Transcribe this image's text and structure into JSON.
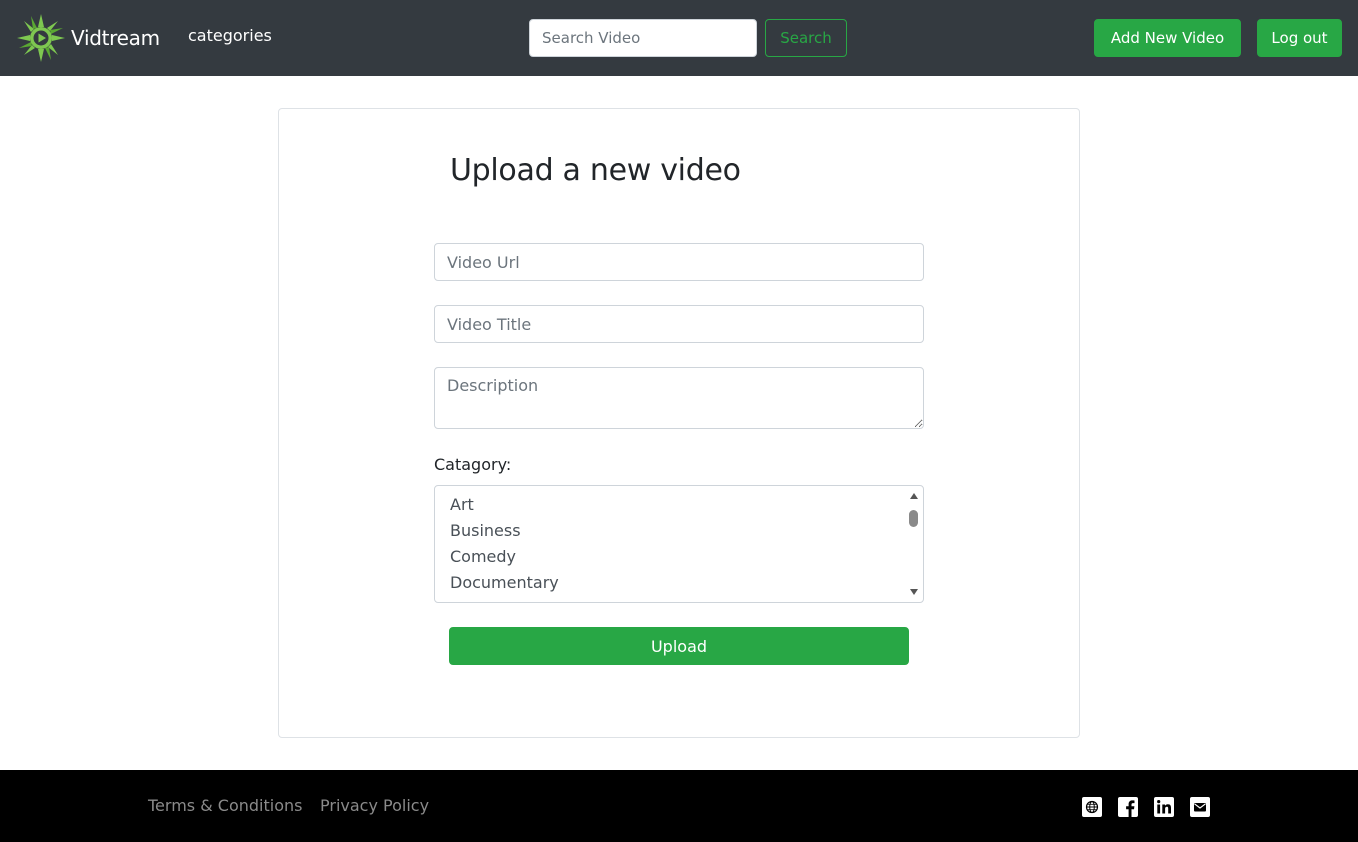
{
  "header": {
    "brand": "Vidtream",
    "nav_categories": "categories",
    "search_placeholder": "Search Video",
    "search_button": "Search",
    "add_button": "Add New Video",
    "logout_button": "Log out"
  },
  "form": {
    "title": "Upload a new video",
    "url_placeholder": "Video Url",
    "title_placeholder": "Video Title",
    "description_placeholder": "Description",
    "category_label": "Catagory:",
    "categories": [
      "Art",
      "Business",
      "Comedy",
      "Documentary"
    ],
    "upload_button": "Upload"
  },
  "footer": {
    "terms": "Terms & Conditions",
    "privacy": "Privacy Policy",
    "social_icons": [
      "globe-icon",
      "facebook-icon",
      "linkedin-icon",
      "mail-icon"
    ]
  },
  "colors": {
    "navbar": "#343a40",
    "accent_green": "#28a745",
    "footer": "#000000",
    "logo_green": "#7ec850"
  }
}
